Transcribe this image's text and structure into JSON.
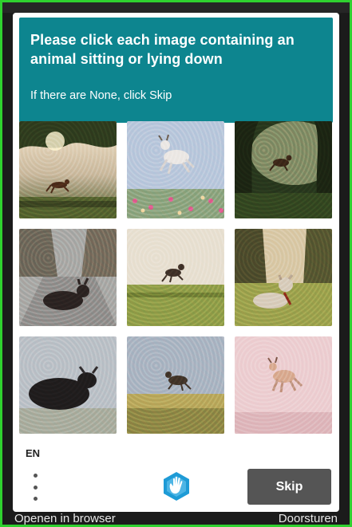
{
  "captcha": {
    "prompt": "Please click each image containing an animal sitting or lying down",
    "subprompt": "If there are None, click Skip",
    "language": "EN",
    "skip_label": "Skip",
    "logo_icon": "hand-logo-icon",
    "menu_icon": "more-vertical-icon",
    "header_color": "#0d858f",
    "skip_color": "#555555",
    "images": [
      {
        "subject": "deer leaping in a forest field",
        "pose": "leaping"
      },
      {
        "subject": "goat jumping over flowers",
        "pose": "jumping"
      },
      {
        "subject": "animal jumping in dark forest",
        "pose": "jumping"
      },
      {
        "subject": "dark animal lying on a road",
        "pose": "lying"
      },
      {
        "subject": "animal jumping over grass",
        "pose": "jumping"
      },
      {
        "subject": "dog lying in grass",
        "pose": "lying"
      },
      {
        "subject": "black cow lying on grass",
        "pose": "lying"
      },
      {
        "subject": "animal leaping over field",
        "pose": "leaping"
      },
      {
        "subject": "goat jumping on pastel background",
        "pose": "jumping"
      }
    ]
  },
  "background": {
    "left_text": "Openen in browser",
    "right_text": "Doorsturen",
    "frame_color": "#2fd12f"
  }
}
